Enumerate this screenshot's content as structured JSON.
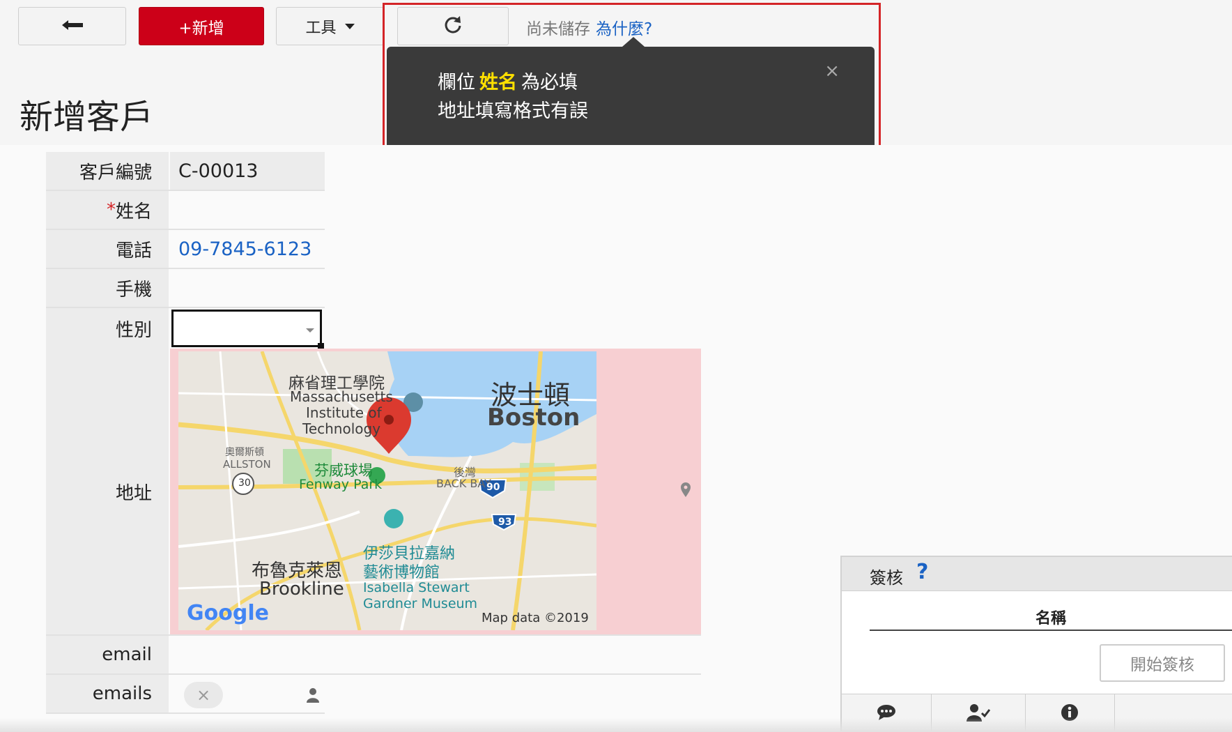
{
  "toolbar": {
    "back_icon": "arrow-left-icon",
    "add_label": "+新增",
    "tools_label": "工具",
    "refresh_icon": "refresh-icon",
    "save_status": "尚未儲存",
    "why_link": "為什麼?"
  },
  "error_popup": {
    "line1_prefix": "欄位",
    "line1_field": "姓名",
    "line1_suffix": "為必填",
    "line2": "地址填寫格式有誤",
    "close_label": "×",
    "highlight_color": "#d42427"
  },
  "page": {
    "title": "新增客戶"
  },
  "form": {
    "customer_no": {
      "label": "客戶編號",
      "value": "C-00013"
    },
    "name": {
      "required_mark": "*",
      "label": "姓名",
      "value": ""
    },
    "phone": {
      "label": "電話",
      "value": "09-7845-6123"
    },
    "mobile": {
      "label": "手機",
      "value": ""
    },
    "gender": {
      "label": "性別",
      "value": ""
    },
    "address": {
      "label": "地址",
      "map": {
        "mit_zh": "麻省理工學院",
        "mit_en1": "Massachusetts",
        "mit_en2": "Institute of",
        "mit_en3": "Technology",
        "boston_zh": "波士頓",
        "boston_en": "Boston",
        "allston_zh": "奧爾斯頓",
        "allston_en": "ALLSTON",
        "fenway_zh": "芬威球場",
        "fenway_en": "Fenway Park",
        "backbay_zh": "後灣",
        "backbay_en": "BACK BAY",
        "route_30": "30",
        "route_90": "90",
        "route_93": "93",
        "brookline_zh": "布魯克萊恩",
        "brookline_en": "Brookline",
        "isabella_zh1": "伊莎貝拉嘉納",
        "isabella_zh2": "藝術博物館",
        "isabella_en1": "Isabella Stewart",
        "isabella_en2": "Gardner Museum",
        "google": "Google",
        "credit": "Map data ©2019"
      }
    },
    "email": {
      "label": "email",
      "value": ""
    },
    "emails": {
      "label": "emails"
    }
  },
  "sign_panel": {
    "title": "簽核",
    "help": "?",
    "column_name": "名稱",
    "start_button": "開始簽核",
    "tabs": [
      "comment-icon",
      "user-check-icon",
      "info-icon"
    ]
  }
}
